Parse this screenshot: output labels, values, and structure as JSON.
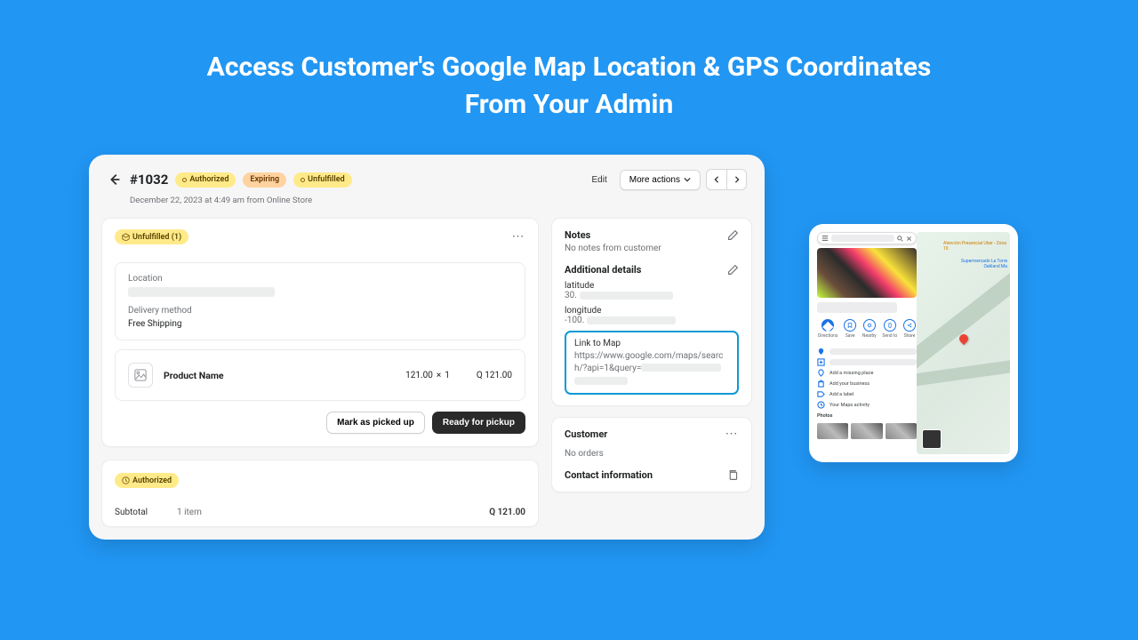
{
  "hero": {
    "line1": "Access Customer's Google Map Location & GPS Coordinates",
    "line2": "From Your Admin"
  },
  "order": {
    "number": "#1032",
    "badges": {
      "authorized": "Authorized",
      "expiring": "Expiring",
      "unfulfilled": "Unfulfilled"
    },
    "meta": "December 22, 2023 at 4:49 am from Online Store",
    "actions": {
      "edit": "Edit",
      "more": "More actions"
    }
  },
  "fulfillment": {
    "badge": "Unfulfilled (1)",
    "location_label": "Location",
    "delivery_label": "Delivery method",
    "delivery_value": "Free Shipping",
    "product": {
      "name": "Product Name",
      "unit_price": "121.00",
      "sep": "×",
      "qty": "1",
      "total": "Q 121.00"
    },
    "btn_picked": "Mark as picked up",
    "btn_ready": "Ready for pickup"
  },
  "payment": {
    "badge": "Authorized",
    "subtotal_label": "Subtotal",
    "subtotal_items": "1 item",
    "subtotal_amount": "Q 121.00"
  },
  "right": {
    "notes_title": "Notes",
    "notes_empty": "No notes from customer",
    "details_title": "Additional details",
    "lat_label": "latitude",
    "lat_prefix": "30.",
    "lng_label": "longitude",
    "lng_prefix": "-100.",
    "link_label": "Link to Map",
    "link_url": "https://www.google.com/maps/search/?api=1&query=",
    "customer_title": "Customer",
    "customer_empty": "No orders",
    "contact_title": "Contact information"
  },
  "map": {
    "actions": {
      "directions": "Directions",
      "save": "Save",
      "nearby": "Nearby",
      "send": "Send to",
      "share": "Share"
    },
    "add_missing": "Add a missing place",
    "add_business": "Add your business",
    "add_label": "Add a label",
    "activity": "Your Maps activity",
    "photos": "Photos",
    "poi1": "Supermercado La Torre Oakland Ma",
    "poi2": "Atención Presencial Uber - Zona 10"
  }
}
